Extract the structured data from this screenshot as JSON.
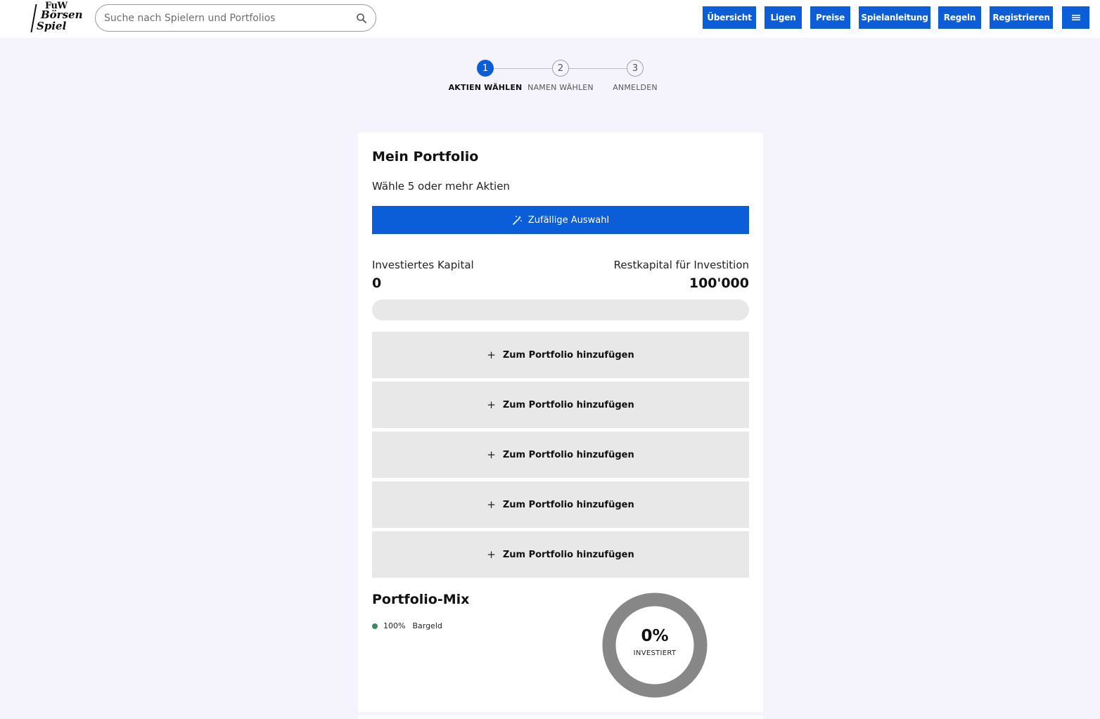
{
  "header": {
    "logo": {
      "line1": "FuW",
      "line2": "Börsen",
      "line3": "Spiel"
    },
    "search": {
      "placeholder": "Suche nach Spielern und Portfolios",
      "icon": "search-icon"
    },
    "nav": [
      {
        "label": "Übersicht"
      },
      {
        "label": "Ligen"
      },
      {
        "label": "Preise"
      },
      {
        "label": "Spielanleitung"
      },
      {
        "label": "Regeln"
      },
      {
        "label": "Registrieren"
      }
    ],
    "menu_icon": "hamburger-menu-icon",
    "accent_color": "#0b5ed7"
  },
  "stepper": {
    "steps": [
      {
        "number": "1",
        "label": "AKTIEN WÄHLEN",
        "active": true
      },
      {
        "number": "2",
        "label": "NAMEN WÄHLEN",
        "active": false
      },
      {
        "number": "3",
        "label": "ANMELDEN",
        "active": false
      }
    ]
  },
  "portfolio": {
    "title": "Mein Portfolio",
    "subtitle": "Wähle 5 oder mehr Aktien",
    "random_button": {
      "label": "Zufällige Auswahl",
      "icon": "magic-wand-icon"
    },
    "invested": {
      "label": "Investiertes Kapital",
      "value": "0"
    },
    "remaining": {
      "label": "Restkapital für Investition",
      "value": "100'000"
    },
    "invested_fraction": 0,
    "slots": [
      {
        "label": "Zum Portfolio hinzufügen"
      },
      {
        "label": "Zum Portfolio hinzufügen"
      },
      {
        "label": "Zum Portfolio hinzufügen"
      },
      {
        "label": "Zum Portfolio hinzufügen"
      },
      {
        "label": "Zum Portfolio hinzufügen"
      }
    ]
  },
  "mix": {
    "title": "Portfolio-Mix",
    "legend": [
      {
        "percent": "100%",
        "label": "Bargeld",
        "color": "#3d8b5a"
      }
    ],
    "donut": {
      "value": "0%",
      "label": "INVESTIERT",
      "ring_color": "#878787"
    }
  }
}
